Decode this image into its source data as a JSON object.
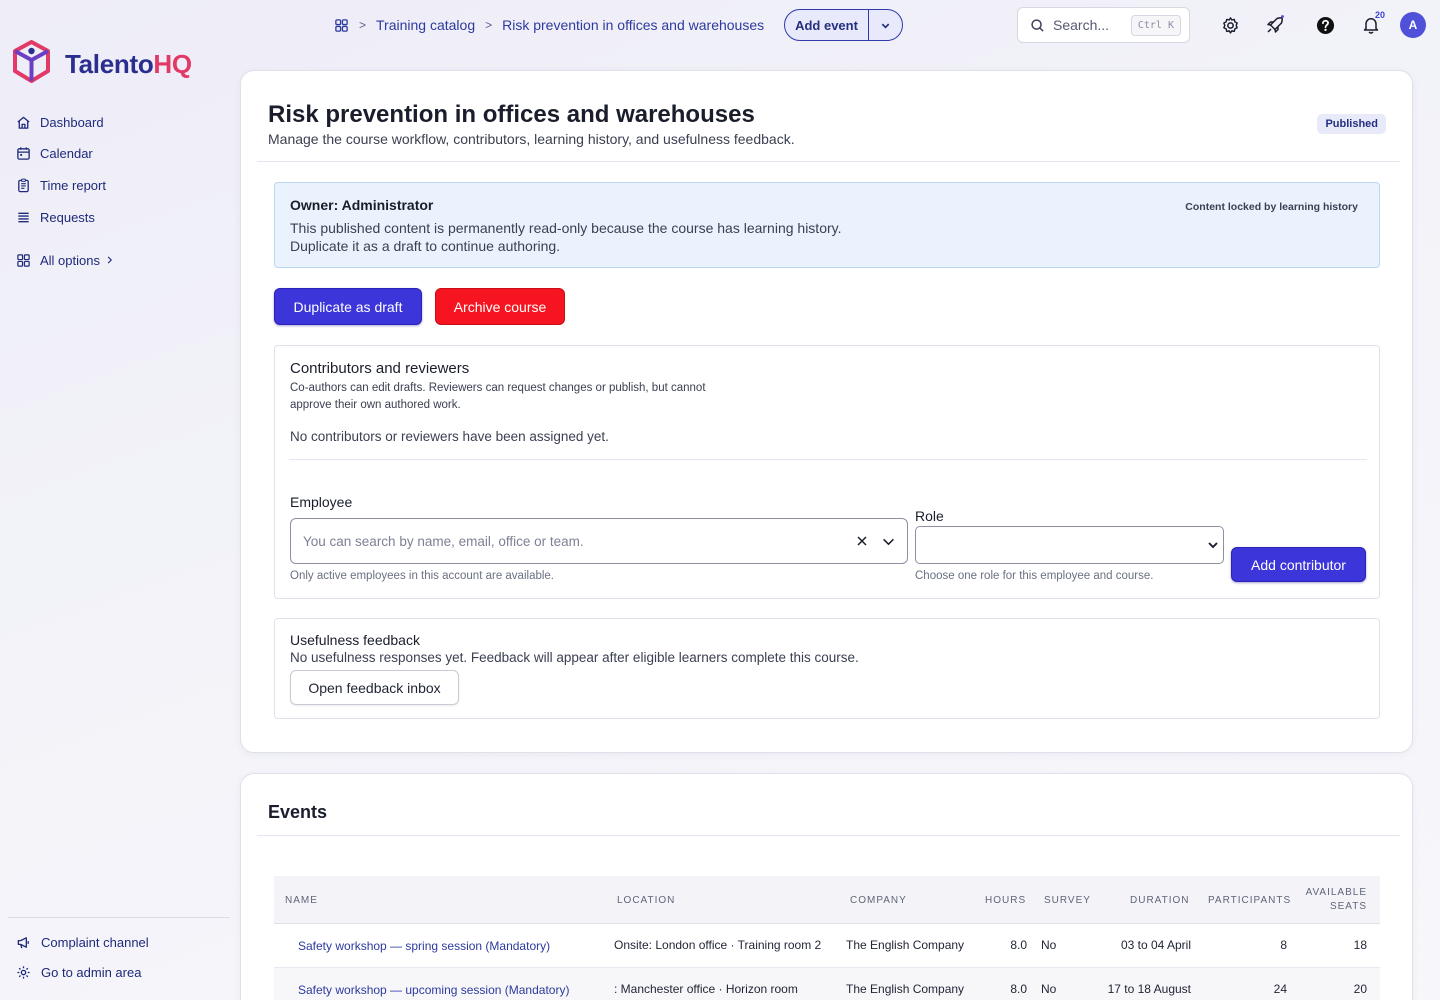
{
  "brand": {
    "name_main": "Talento",
    "name_accent": "HQ"
  },
  "sidebar": {
    "items": [
      {
        "label": "Dashboard",
        "icon": "home-icon"
      },
      {
        "label": "Calendar",
        "icon": "calendar-icon"
      },
      {
        "label": "Time report",
        "icon": "clipboard-icon"
      },
      {
        "label": "Requests",
        "icon": "list-icon"
      },
      {
        "label": "All options",
        "icon": "grid-icon"
      }
    ],
    "bottom": [
      {
        "label": "Complaint channel",
        "icon": "megaphone-icon"
      },
      {
        "label": "Go to admin area",
        "icon": "gear-icon"
      }
    ]
  },
  "topbar": {
    "breadcrumb": [
      "Training catalog",
      "Risk prevention in offices and warehouses"
    ],
    "add_event_label": "Add event",
    "search_placeholder": "Search...",
    "search_shortcut": "Ctrl K",
    "notification_count": "20",
    "avatar_initial": "A"
  },
  "course": {
    "title": "Risk prevention in offices and warehouses",
    "subtitle": "Manage the course workflow, contributors, learning history, and usefulness feedback.",
    "status": "Published",
    "alert": {
      "owner": "Owner: Administrator",
      "line1": "This published content is permanently read-only because the course has learning history.",
      "line2": "Duplicate it as a draft to continue authoring.",
      "lock_note": "Content locked by learning history"
    },
    "actions": {
      "duplicate": "Duplicate as draft",
      "archive": "Archive course"
    }
  },
  "contributors": {
    "title": "Contributors and reviewers",
    "desc_line1": "Co-authors can edit drafts. Reviewers can request changes or publish, but cannot",
    "desc_line2": "approve their own authored work.",
    "empty": "No contributors or reviewers have been assigned yet.",
    "employee_label": "Employee",
    "employee_placeholder": "You can search by name, email, office or team.",
    "employee_hint": "Only active employees in this account are available.",
    "role_label": "Role",
    "role_value": "",
    "role_hint": "Choose one role for this employee and course.",
    "add_button": "Add contributor"
  },
  "feedback": {
    "title": "Usefulness feedback",
    "text": "No usefulness responses yet. Feedback will appear after eligible learners complete this course.",
    "button": "Open feedback inbox"
  },
  "events": {
    "title": "Events",
    "columns": [
      "Name",
      "Location",
      "Company",
      "Hours",
      "Survey",
      "Duration",
      "Participants",
      "Available",
      "seats"
    ],
    "rows": [
      {
        "name": "Safety workshop — spring session (Mandatory)",
        "location": "Onsite: London office · Training room 2",
        "company": "The English Company",
        "hours": "8.0",
        "survey": "No",
        "duration": "03 to 04 April",
        "participants": "8",
        "seats": "18"
      },
      {
        "name": "Safety workshop — upcoming session (Mandatory)",
        "location": ": Manchester office · Horizon room",
        "company": "The English Company",
        "hours": "8.0",
        "survey": "No",
        "duration": "17 to 18 August",
        "participants": "24",
        "seats": "20"
      }
    ]
  },
  "colors": {
    "primary": "#3c35d9",
    "danger": "#f5141f",
    "brand_blue": "#2a2f8f",
    "brand_pink": "#e23a66",
    "link": "#2d3a9e"
  }
}
